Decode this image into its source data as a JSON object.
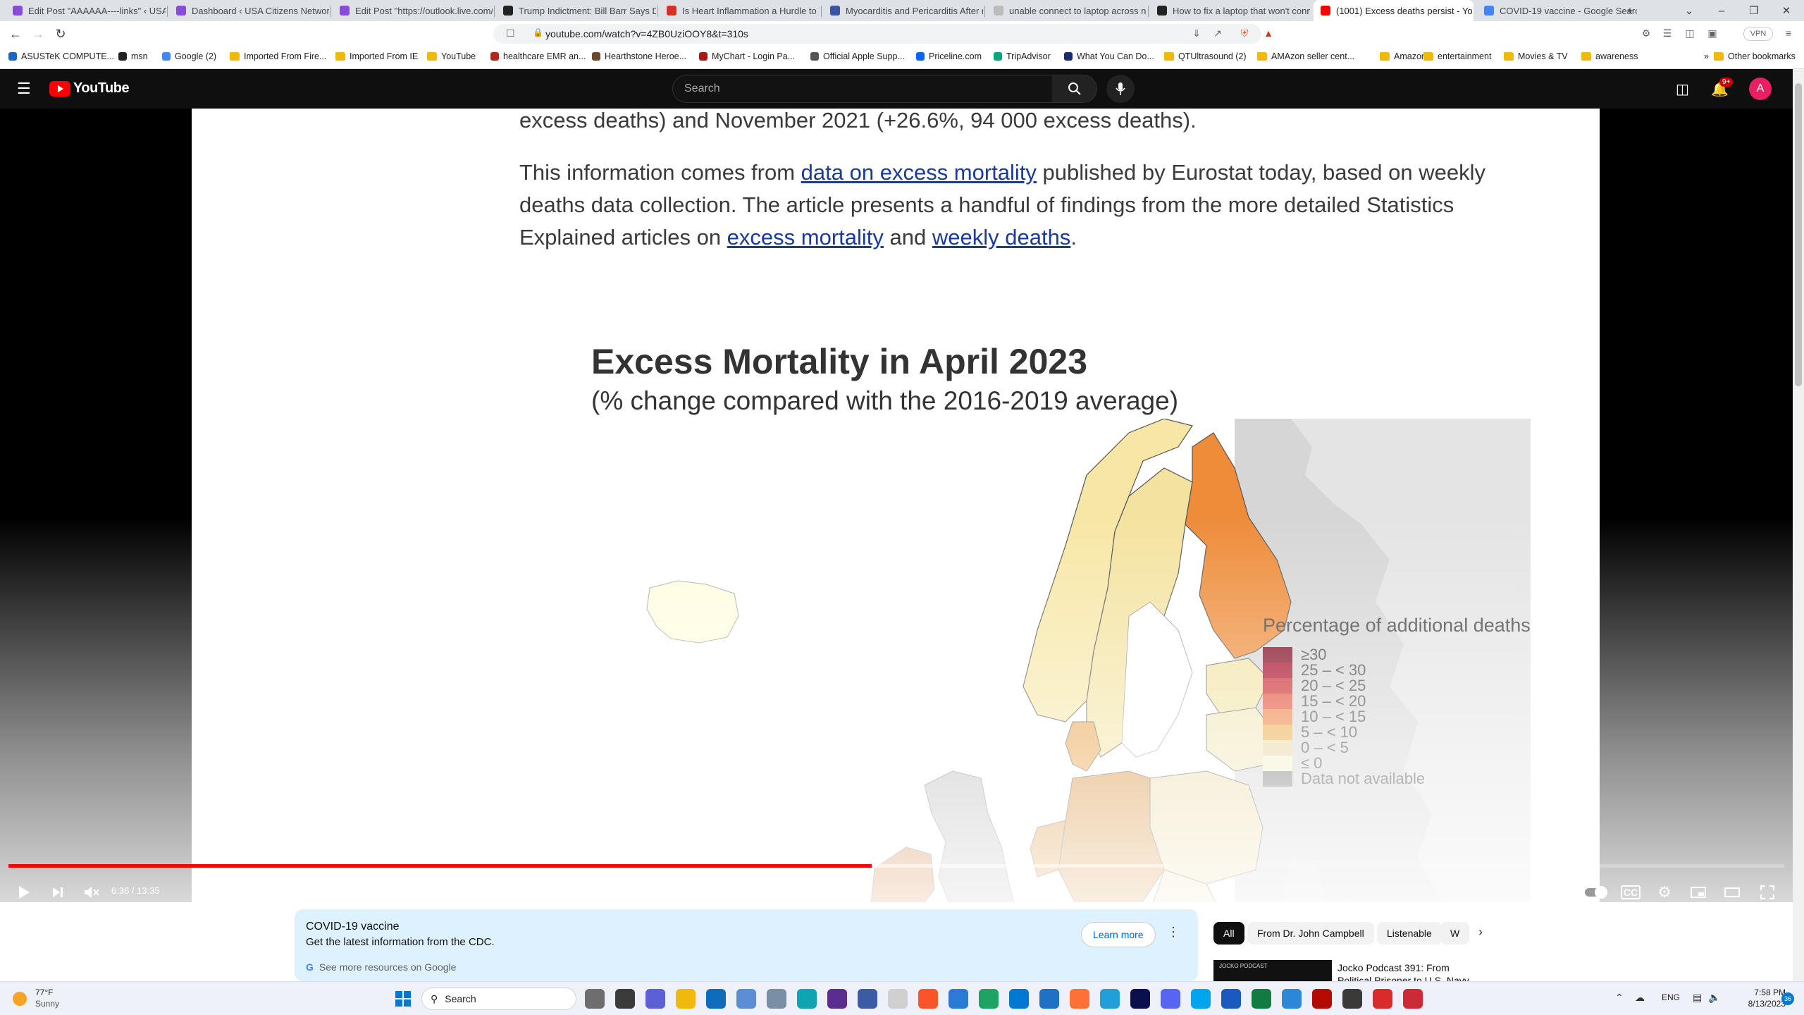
{
  "browser": {
    "tabs": [
      {
        "title": "Edit Post \"AAAAAA----links\" ‹ USA C",
        "color": "#8a4bd6"
      },
      {
        "title": "Dashboard ‹ USA Citizens Network –",
        "color": "#8a4bd6"
      },
      {
        "title": "Edit Post \"https://outlook.live.com/",
        "color": "#8a4bd6"
      },
      {
        "title": "Trump Indictment: Bill Barr Says Do",
        "color": "#222222"
      },
      {
        "title": "Is Heart Inflammation a Hurdle to Va",
        "color": "#d93025"
      },
      {
        "title": "Myocarditis and Pericarditis After m",
        "color": "#3955a3"
      },
      {
        "title": "unable connect to laptop across net",
        "color": "#bbbbbb"
      },
      {
        "title": "How to fix a laptop that won't conne",
        "color": "#222222"
      },
      {
        "title": "(1001) Excess deaths persist - Yo",
        "color": "#ff0000"
      },
      {
        "title": "COVID-19 vaccine - Google Search",
        "color": "#4285f4"
      }
    ],
    "url": "youtube.com/watch?v=4ZB0UziOOY8&t=310s",
    "vpn_label": "VPN",
    "bookmarks": [
      {
        "label": "ASUSTeK COMPUTE...",
        "type": "site",
        "color": "#1c67c4"
      },
      {
        "label": "msn",
        "type": "site",
        "color": "#222222"
      },
      {
        "label": "Google (2)",
        "type": "site",
        "color": "#4285f4"
      },
      {
        "label": "Imported From Fire...",
        "type": "folder"
      },
      {
        "label": "Imported From IE",
        "type": "folder"
      },
      {
        "label": "YouTube",
        "type": "folder"
      },
      {
        "label": "healthcare EMR an...",
        "type": "site",
        "color": "#b3261e"
      },
      {
        "label": "Hearthstone Heroe...",
        "type": "site",
        "color": "#6b4a2b"
      },
      {
        "label": "MyChart - Login Pa...",
        "type": "site",
        "color": "#a31c1c"
      },
      {
        "label": "Official Apple Supp...",
        "type": "site",
        "color": "#555555"
      },
      {
        "label": "Priceline.com",
        "type": "site",
        "color": "#0068ef"
      },
      {
        "label": "TripAdvisor",
        "type": "site",
        "color": "#00a680"
      },
      {
        "label": "What You Can Do...",
        "type": "site",
        "color": "#1a2a6c"
      },
      {
        "label": "QTUltrasound (2)",
        "type": "folder"
      },
      {
        "label": "AMAzon seller cent...",
        "type": "folder"
      },
      {
        "label": "Amazon",
        "type": "folder"
      },
      {
        "label": "entertainment",
        "type": "folder"
      },
      {
        "label": "Movies & TV",
        "type": "folder"
      },
      {
        "label": "awareness",
        "type": "folder"
      }
    ],
    "other_bookmarks": "Other bookmarks"
  },
  "youtube": {
    "logo_text": "YouTube",
    "search_placeholder": "Search",
    "notif_count": "9+",
    "avatar_letter": "A"
  },
  "video_frame": {
    "para1_tail": "excess deaths) and November 2021 (+26.6%, 94 000 excess deaths).",
    "para2_a": "This information comes from ",
    "para2_link1": "data on excess mortality",
    "para2_b": " published by Eurostat today, based on weekly deaths data collection. The article presents a handful of findings from the more detailed Statistics Explained articles on ",
    "para2_link2": "excess mortality",
    "para2_c": " and ",
    "para2_link3": "weekly deaths",
    "para2_d": ".",
    "map_title": "Excess Mortality in April 2023",
    "map_subtitle": "(% change compared with the 2016-2019 average)",
    "legend_title": "Percentage of additional deaths",
    "legend": [
      {
        "label": "≥30",
        "color": "#7a0019"
      },
      {
        "label": "25 – < 30",
        "color": "#a3001f"
      },
      {
        "label": "20 – < 25",
        "color": "#c81e24"
      },
      {
        "label": "15 – < 20",
        "color": "#e2472c"
      },
      {
        "label": "10 – < 15",
        "color": "#ec7a34"
      },
      {
        "label": "5 – < 10",
        "color": "#e9a83f"
      },
      {
        "label": "0 – < 5",
        "color": "#e7d59a"
      },
      {
        "label": "≤ 0",
        "color": "#f3f0c8"
      },
      {
        "label": "Data not available",
        "color": "#7b7b7b"
      }
    ]
  },
  "player": {
    "time": "6:36 / 13:35",
    "progress": 0.486,
    "buffered": 0.65
  },
  "below": {
    "card_title": "COVID-19 vaccine",
    "card_text": "Get the latest information from the CDC.",
    "card_link": "See more resources on Google",
    "learn_more": "Learn more",
    "chips": [
      "All",
      "From Dr. John Campbell",
      "Listenable",
      "W"
    ],
    "rec_title_1": "Jocko Podcast 391: From",
    "rec_title_2": "Political Prisoner to U.S. Navy",
    "rec_thumb_text": "JOCKO PODCAST"
  },
  "taskbar": {
    "temp": "77°F",
    "weather": "Sunny",
    "search": "Search",
    "lang": "ENG",
    "time": "7:58 PM",
    "date": "8/13/2023",
    "badge": "36"
  }
}
